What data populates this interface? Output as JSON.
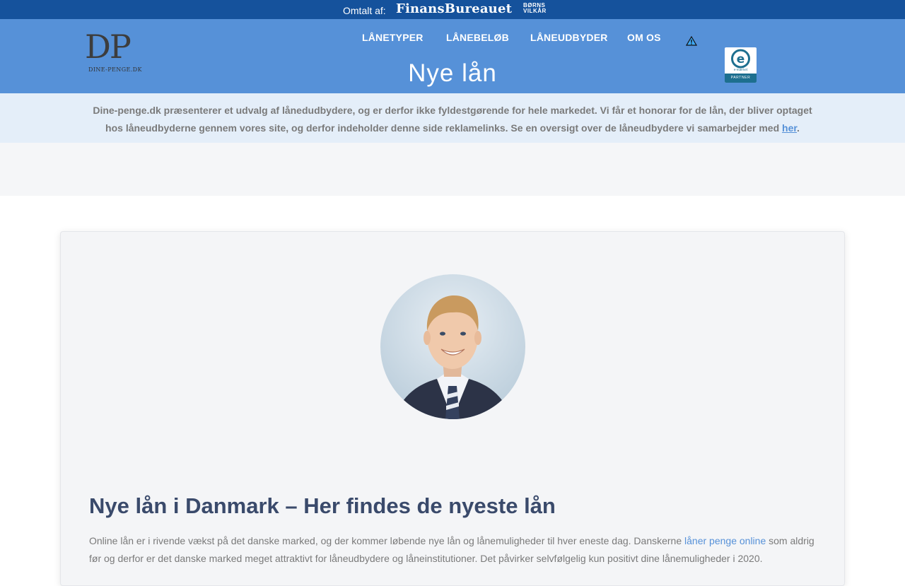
{
  "topbar": {
    "mentioned_label": "Omtalt af:",
    "media_1": "FinansBureauet",
    "media_2_line1": "BØRNS",
    "media_2_line2": "VILKÅR"
  },
  "header": {
    "logo_letters": "DP",
    "logo_sub": "DINE-PENGE.DK",
    "nav": [
      "LÅNETYPER",
      "LÅNEBELØB",
      "LÅNEUDBYDER",
      "OM OS"
    ],
    "title": "Nye lån",
    "badge_label": "PARTNER",
    "badge_mark": "e-mærket"
  },
  "disclaimer": {
    "text": "Dine-penge.dk præsenterer et udvalg af lånedudbydere, og er derfor ikke fyldestgørende for hele markedet. Vi får et honorar for de lån, der bliver optaget hos låneudbyderne gennem vores site, og derfor indeholder denne side reklamelinks. Se en oversigt over de låneudbydere vi samarbejder med",
    "link": "her",
    "end": "."
  },
  "article": {
    "heading": "Nye lån i Danmark – Her findes de nyeste lån",
    "para_before": "Online lån er i rivende vækst på det danske marked, og der kommer løbende nye lån og lånemuligheder til hver eneste dag. Danskerne ",
    "para_link": "låner penge online",
    "para_after": " som aldrig før og derfor er det danske marked meget attraktivt for låneudbydere og låneinstitutioner. Det påvirker selvfølgelig kun positivt dine lånemuligheder i 2020."
  },
  "colors": {
    "topbar": "#15529c",
    "header": "#5691d8",
    "heading": "#3a4a6b",
    "link": "#5691d8"
  }
}
